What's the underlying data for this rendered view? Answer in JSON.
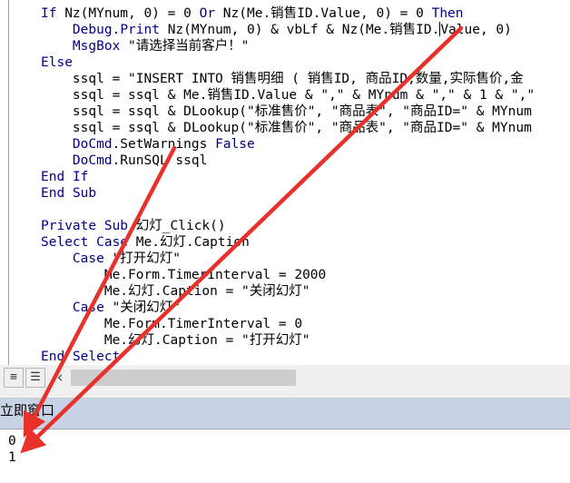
{
  "code_lines": [
    "If Nz(MYnum, 0) = 0 Or Nz(Me.销售ID.Value, 0) = 0 Then",
    "    Debug.Print Nz(MYnum, 0) & vbLf & Nz(Me.销售ID.Value, 0)",
    "    MsgBox \"请选择当前客户！\"",
    "Else",
    "    ssql = \"INSERT INTO 销售明细 ( 销售ID, 商品ID,数量,实际售价,金",
    "    ssql = ssql & Me.销售ID.Value & \",\" & MYnum & \",\" & 1 & \",\"",
    "    ssql = ssql & DLookup(\"标准售价\", \"商品表\", \"商品ID=\" & MYnum",
    "    ssql = ssql & DLookup(\"标准售价\", \"商品表\", \"商品ID=\" & MYnum",
    "    DoCmd.SetWarnings False",
    "    DoCmd.RunSQL ssql",
    "End If",
    "End Sub",
    "",
    "Private Sub 幻灯_Click()",
    "Select Case Me.幻灯.Caption",
    "    Case \"打开幻灯\"",
    "        Me.Form.TimerInterval = 2000",
    "        Me.幻灯.Caption = \"关闭幻灯\"",
    "    Case \"关闭幻灯\"",
    "        Me.Form.TimerInterval = 0",
    "        Me.幻灯.Caption = \"打开幻灯\"",
    "End Select"
  ],
  "keywords": [
    "If",
    "Or",
    "Then",
    "Debug",
    "Print",
    "MsgBox",
    "Else",
    "DoCmd",
    "End",
    "Sub",
    "Private",
    "Select",
    "Case",
    "False"
  ],
  "toolbar": {
    "procedure_view_glyph": "≡",
    "module_view_glyph": "☰",
    "scroll_left_glyph": "‹"
  },
  "immediate": {
    "title": "立即窗口",
    "output": [
      "0",
      "1"
    ]
  },
  "colors": {
    "keyword": "#00008b",
    "arrow": "#e8312b",
    "title_bar": "#c7d2e4"
  },
  "icons": [
    "procedure-view-icon",
    "full-module-view-icon",
    "scroll-left-icon",
    "annotation-arrow-icon"
  ]
}
